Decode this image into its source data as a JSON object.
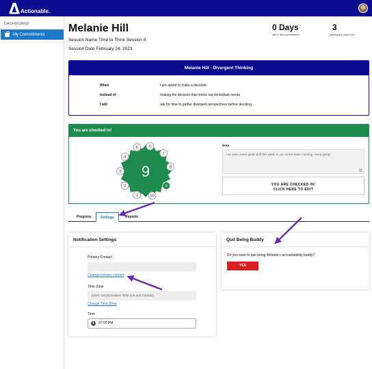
{
  "brand": {
    "logo_text": "Actionable."
  },
  "sidebar": {
    "section_label": "DASHBOARD",
    "items": [
      {
        "label": "My Commitments",
        "icon": "briefcase-icon"
      }
    ]
  },
  "header": {
    "name": "Melanie Hill",
    "session_name": "Session Name Time to Think Session 4",
    "session_date": "Session Date February 24, 2023",
    "stats": [
      {
        "value": "0 Days",
        "label": "left in this commitment"
      },
      {
        "value": "3",
        "label": "participant check ins"
      }
    ]
  },
  "commitment": {
    "title": "Melanie Hill - Divergent Thinking",
    "rows": [
      {
        "key": "When",
        "value": "I am asked to make a decision"
      },
      {
        "key": "Instead of",
        "value": "making the decision that meets our immediate needs"
      },
      {
        "key": "I will",
        "value": "ask for time to gather divergent perspectives before deciding."
      }
    ]
  },
  "checkin": {
    "header": "You are checked in!",
    "count": "9",
    "dots": [
      "1",
      "2",
      "3",
      "4",
      "5",
      "6",
      "7",
      "8",
      "9",
      "10"
    ],
    "note_label": "Note",
    "note_text": "I've seen some great stuff this week in our recent team meeting. Keep going!",
    "edit_line1": "YOU ARE CHECKED IN!",
    "edit_line2": "CLICK HERE TO EDIT"
  },
  "tabs": [
    {
      "label": "Progress"
    },
    {
      "label": "Settings",
      "active": true
    },
    {
      "label": "Reports"
    }
  ],
  "notifications": {
    "title": "Notification Settings",
    "primary_contact_label": "Primary Contact",
    "primary_contact_value": "",
    "change_contact_link": "Change primary contact",
    "timezone_label": "Time Zone",
    "timezone_value": "(GMT -04:00) Eastern Time (US and Canada)",
    "change_timezone_link": "Change Time Zone",
    "time_label": "Time",
    "time_value": "07:00 PM"
  },
  "quit": {
    "title": "Quit Being Buddy",
    "question": "Do you want to quit being Melanie's accountability buddy?",
    "yes_label": "YES"
  },
  "colors": {
    "brand_navy": "#0b0b8f",
    "sidebar_active": "#1d78c8",
    "checkin_green": "#1d8a4e",
    "yes_red": "#d91f1f",
    "annotation_arrow": "#6a2bb0"
  }
}
